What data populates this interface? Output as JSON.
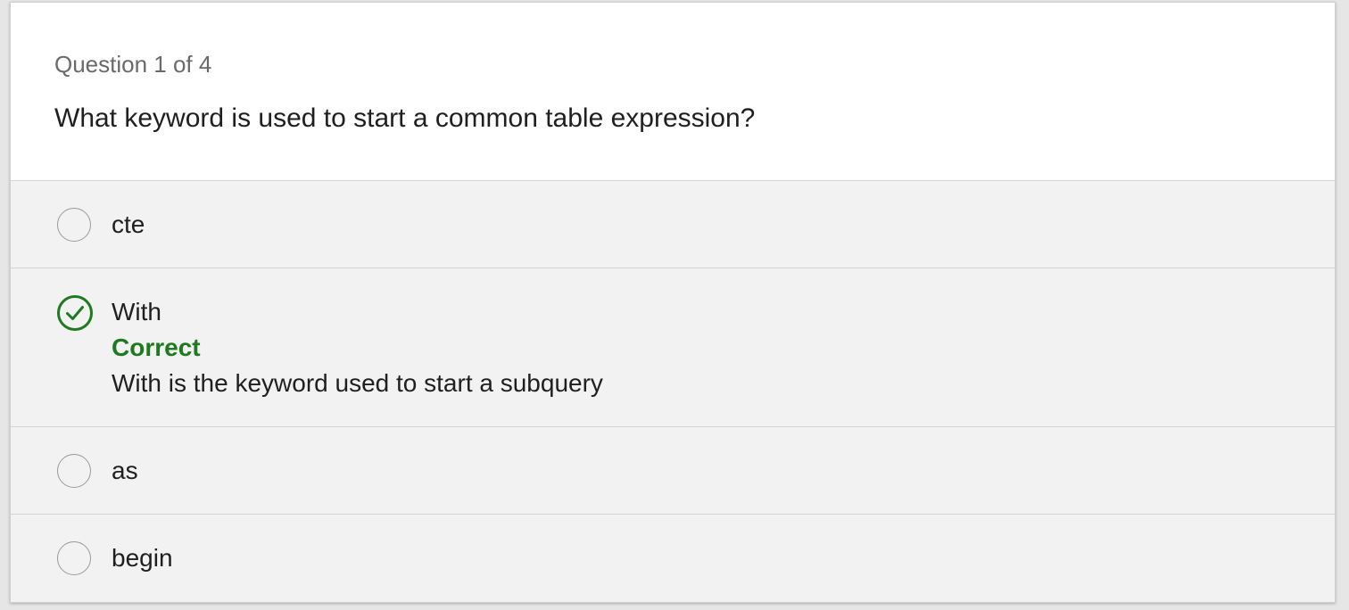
{
  "quiz": {
    "counter": "Question 1 of 4",
    "question": "What keyword is used to start a common table expression?",
    "options": [
      {
        "label": "cte",
        "state": "unselected"
      },
      {
        "label": "With",
        "state": "selected-correct",
        "feedback_status": "Correct",
        "feedback_text": "With is the keyword used to start a subquery"
      },
      {
        "label": "as",
        "state": "unselected"
      },
      {
        "label": "begin",
        "state": "unselected"
      }
    ]
  },
  "colors": {
    "correct": "#1e7a1e",
    "option_background": "#f2f2f2"
  },
  "icons": {
    "selected_option": "check-circle-icon",
    "unselected_option": "radio-circle-icon"
  }
}
